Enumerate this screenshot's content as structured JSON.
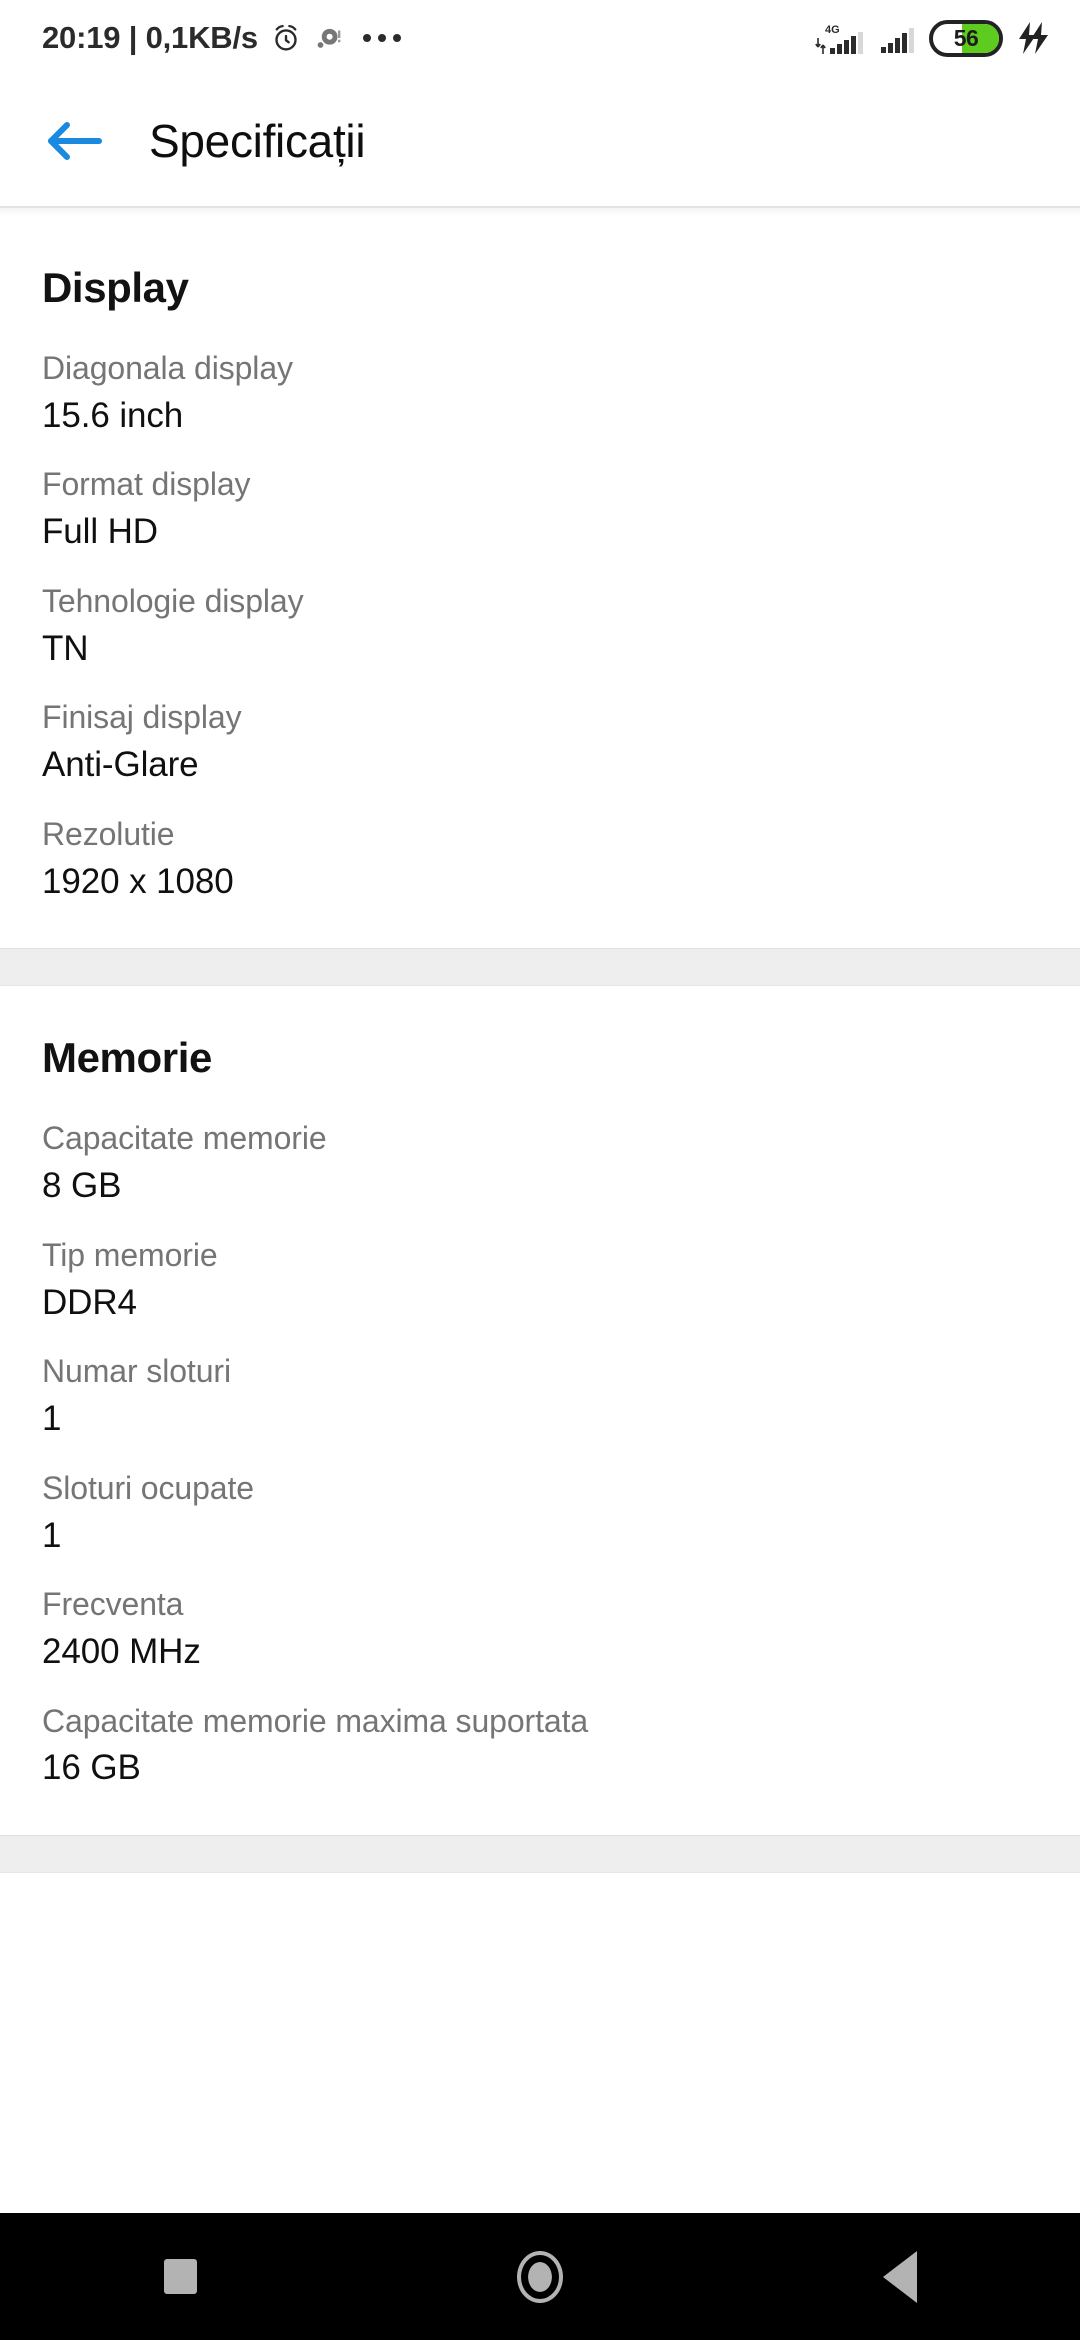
{
  "status_bar": {
    "clock_and_net": "20:19 | 0,1KB/s",
    "alarm_icon": "alarm-clock-icon",
    "notification_icon": "notification-dot-icon",
    "more_notifications_icon": "ellipsis-icon",
    "network_type": "4G",
    "mobile_data_icon": "data-transfer-arrows-icon",
    "signal_icon_1": "signal-bars-icon",
    "signal_icon_2": "signal-bars-icon",
    "battery_level": "56",
    "battery_percent_fill": 56,
    "charging_icon": "fast-charging-bolt-icon",
    "battery_fill_color": "#5ecb1f"
  },
  "app_bar": {
    "back_icon": "arrow-left-icon",
    "back_icon_color": "#1a8ae0",
    "title": "Specificații"
  },
  "sections": [
    {
      "title": "Display",
      "rows": [
        {
          "label": "Diagonala display",
          "value": "15.6 inch"
        },
        {
          "label": "Format display",
          "value": "Full HD"
        },
        {
          "label": "Tehnologie display",
          "value": "TN"
        },
        {
          "label": "Finisaj display",
          "value": "Anti-Glare"
        },
        {
          "label": "Rezolutie",
          "value": "1920 x 1080"
        }
      ]
    },
    {
      "title": "Memorie",
      "rows": [
        {
          "label": "Capacitate memorie",
          "value": "8 GB"
        },
        {
          "label": "Tip memorie",
          "value": "DDR4"
        },
        {
          "label": "Numar sloturi",
          "value": "1"
        },
        {
          "label": "Sloturi ocupate",
          "value": "1"
        },
        {
          "label": "Frecventa",
          "value": "2400 MHz"
        },
        {
          "label": "Capacitate memorie maxima suportata",
          "value": "16 GB"
        }
      ]
    }
  ],
  "nav_bar": {
    "recents_icon": "square-recents-icon",
    "home_icon": "circle-home-icon",
    "back_icon": "triangle-back-icon",
    "icon_color": "#b3b3b3"
  }
}
